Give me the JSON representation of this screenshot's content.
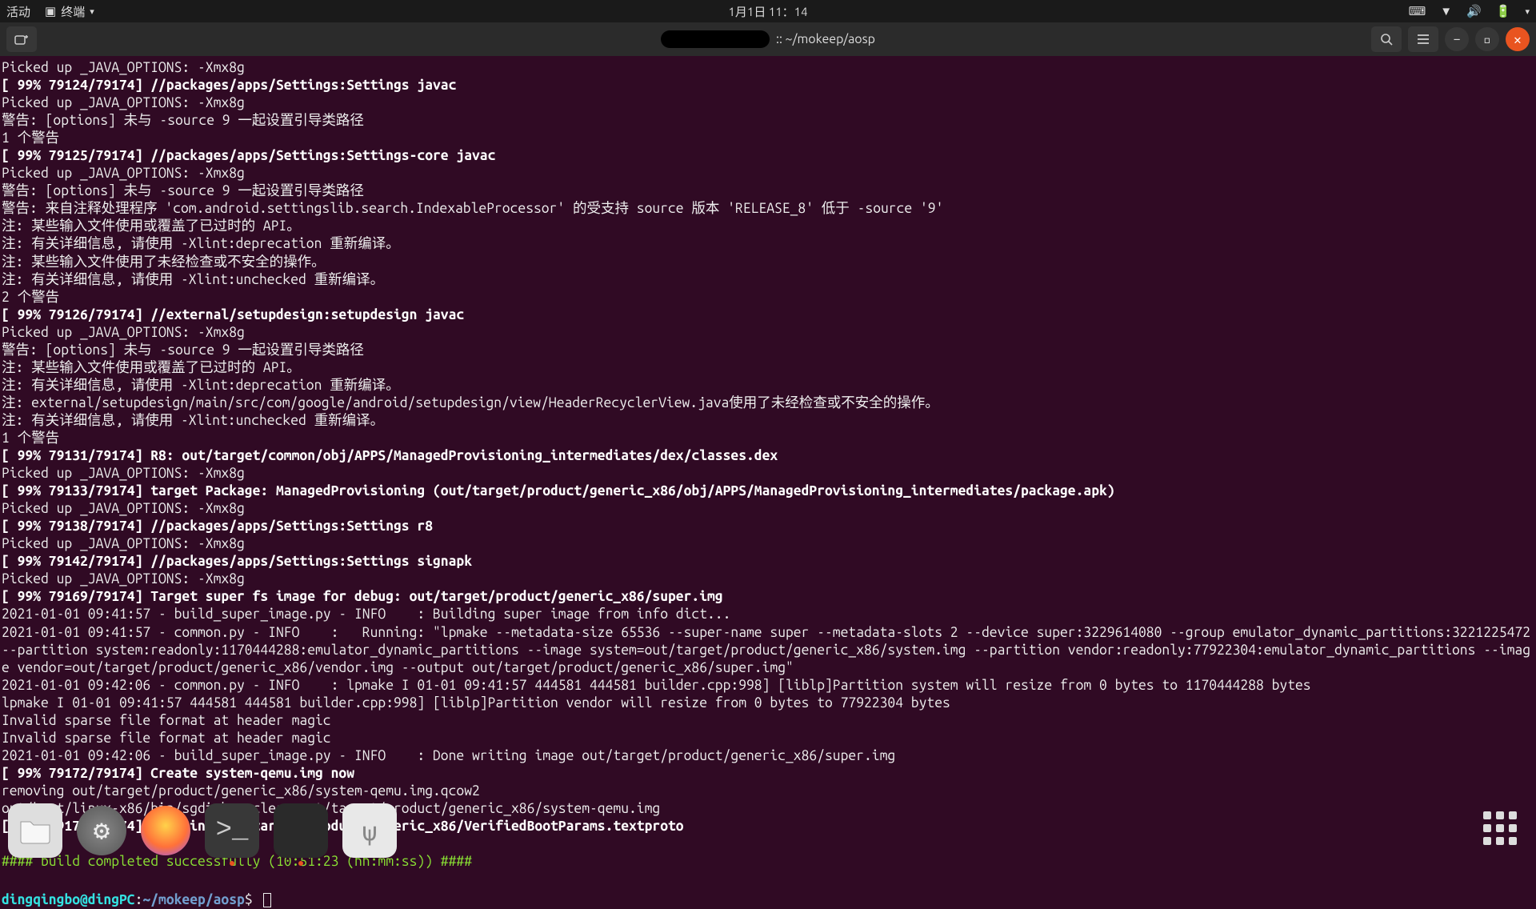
{
  "topbar": {
    "activities": "活动",
    "app": "终端",
    "clock": "1月1日 11：14"
  },
  "titlebar": {
    "path": ":: ~/mokeep/aosp"
  },
  "prompt": {
    "userhost": "dingqingbo@dingPC",
    "sep": ":",
    "cwd": "~/mokeep/aosp",
    "sym": "$"
  },
  "build_success": "#### build completed successfully (10:51:23 (hh:mm:ss)) ####",
  "lines": [
    {
      "t": "n",
      "v": "Picked up _JAVA_OPTIONS: -Xmx8g"
    },
    {
      "t": "b",
      "v": "[ 99% 79124/79174] //packages/apps/Settings:Settings javac"
    },
    {
      "t": "n",
      "v": "Picked up _JAVA_OPTIONS: -Xmx8g"
    },
    {
      "t": "n",
      "v": "警告: [options] 未与 -source 9 一起设置引导类路径"
    },
    {
      "t": "n",
      "v": "1 个警告"
    },
    {
      "t": "b",
      "v": "[ 99% 79125/79174] //packages/apps/Settings:Settings-core javac"
    },
    {
      "t": "n",
      "v": "Picked up _JAVA_OPTIONS: -Xmx8g"
    },
    {
      "t": "n",
      "v": "警告: [options] 未与 -source 9 一起设置引导类路径"
    },
    {
      "t": "n",
      "v": "警告: 来自注释处理程序 'com.android.settingslib.search.IndexableProcessor' 的受支持 source 版本 'RELEASE_8' 低于 -source '9'"
    },
    {
      "t": "n",
      "v": "注: 某些输入文件使用或覆盖了已过时的 API。"
    },
    {
      "t": "n",
      "v": "注: 有关详细信息, 请使用 -Xlint:deprecation 重新编译。"
    },
    {
      "t": "n",
      "v": "注: 某些输入文件使用了未经检查或不安全的操作。"
    },
    {
      "t": "n",
      "v": "注: 有关详细信息, 请使用 -Xlint:unchecked 重新编译。"
    },
    {
      "t": "n",
      "v": "2 个警告"
    },
    {
      "t": "b",
      "v": "[ 99% 79126/79174] //external/setupdesign:setupdesign javac"
    },
    {
      "t": "n",
      "v": "Picked up _JAVA_OPTIONS: -Xmx8g"
    },
    {
      "t": "n",
      "v": "警告: [options] 未与 -source 9 一起设置引导类路径"
    },
    {
      "t": "n",
      "v": "注: 某些输入文件使用或覆盖了已过时的 API。"
    },
    {
      "t": "n",
      "v": "注: 有关详细信息, 请使用 -Xlint:deprecation 重新编译。"
    },
    {
      "t": "n",
      "v": "注: external/setupdesign/main/src/com/google/android/setupdesign/view/HeaderRecyclerView.java使用了未经检查或不安全的操作。"
    },
    {
      "t": "n",
      "v": "注: 有关详细信息, 请使用 -Xlint:unchecked 重新编译。"
    },
    {
      "t": "n",
      "v": "1 个警告"
    },
    {
      "t": "b",
      "v": "[ 99% 79131/79174] R8: out/target/common/obj/APPS/ManagedProvisioning_intermediates/dex/classes.dex"
    },
    {
      "t": "n",
      "v": "Picked up _JAVA_OPTIONS: -Xmx8g"
    },
    {
      "t": "b",
      "v": "[ 99% 79133/79174] target Package: ManagedProvisioning (out/target/product/generic_x86/obj/APPS/ManagedProvisioning_intermediates/package.apk)"
    },
    {
      "t": "n",
      "v": "Picked up _JAVA_OPTIONS: -Xmx8g"
    },
    {
      "t": "b",
      "v": "[ 99% 79138/79174] //packages/apps/Settings:Settings r8"
    },
    {
      "t": "n",
      "v": "Picked up _JAVA_OPTIONS: -Xmx8g"
    },
    {
      "t": "b",
      "v": "[ 99% 79142/79174] //packages/apps/Settings:Settings signapk"
    },
    {
      "t": "n",
      "v": "Picked up _JAVA_OPTIONS: -Xmx8g"
    },
    {
      "t": "b",
      "v": "[ 99% 79169/79174] Target super fs image for debug: out/target/product/generic_x86/super.img"
    },
    {
      "t": "n",
      "v": "2021-01-01 09:41:57 - build_super_image.py - INFO    : Building super image from info dict..."
    },
    {
      "t": "n",
      "v": "2021-01-01 09:41:57 - common.py - INFO    :   Running: \"lpmake --metadata-size 65536 --super-name super --metadata-slots 2 --device super:3229614080 --group emulator_dynamic_partitions:3221225472 --partition system:readonly:1170444288:emulator_dynamic_partitions --image system=out/target/product/generic_x86/system.img --partition vendor:readonly:77922304:emulator_dynamic_partitions --image vendor=out/target/product/generic_x86/vendor.img --output out/target/product/generic_x86/super.img\""
    },
    {
      "t": "n",
      "v": "2021-01-01 09:42:06 - common.py - INFO    : lpmake I 01-01 09:41:57 444581 444581 builder.cpp:998] [liblp]Partition system will resize from 0 bytes to 1170444288 bytes"
    },
    {
      "t": "n",
      "v": "lpmake I 01-01 09:41:57 444581 444581 builder.cpp:998] [liblp]Partition vendor will resize from 0 bytes to 77922304 bytes"
    },
    {
      "t": "n",
      "v": "Invalid sparse file format at header magic"
    },
    {
      "t": "n",
      "v": "Invalid sparse file format at header magic"
    },
    {
      "t": "n",
      "v": "2021-01-01 09:42:06 - build_super_image.py - INFO    : Done writing image out/target/product/generic_x86/super.img"
    },
    {
      "t": "b",
      "v": "[ 99% 79172/79174] Create system-qemu.img now"
    },
    {
      "t": "n",
      "v": "removing out/target/product/generic_x86/system-qemu.img.qcow2"
    },
    {
      "t": "n",
      "v": "out/host/linux-x86/bin/sgdisk --clear out/target/product/generic_x86/system-qemu.img"
    },
    {
      "t": "b",
      "v": "[100% 79174/79174] Creating out/target/product/generic_x86/VerifiedBootParams.textproto"
    }
  ]
}
